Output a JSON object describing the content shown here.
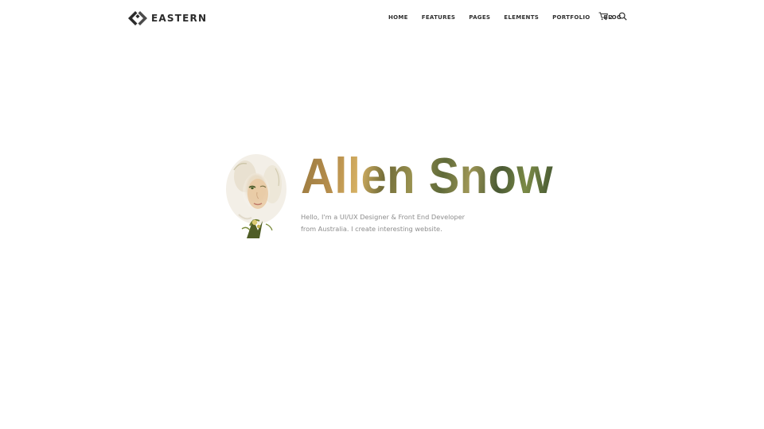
{
  "brand": {
    "name": "EASTERN",
    "logo_icon": "eastern-logo-icon"
  },
  "nav": {
    "items": [
      {
        "label": "HOME"
      },
      {
        "label": "FEATURES"
      },
      {
        "label": "PAGES"
      },
      {
        "label": "ELEMENTS"
      },
      {
        "label": "PORTFOLIO"
      },
      {
        "label": "BLOG"
      }
    ],
    "cart_icon": "cart-icon",
    "cart_count": "2",
    "search_icon": "search-icon"
  },
  "hero": {
    "name": "Allen Snow",
    "bio_line_1": "Hello, I'm a UI/UX Designer & Front End Developer",
    "bio_line_2": "from Australia. I create interesting website.",
    "portrait": "double-exposure-portrait-image"
  },
  "colors": {
    "text_dark": "#2f2f2f",
    "text_muted": "#8d8d8d",
    "name_gradient": [
      "#b78e4c",
      "#d6b163",
      "#6f6a37",
      "#5f6a39",
      "#3f5230"
    ]
  }
}
